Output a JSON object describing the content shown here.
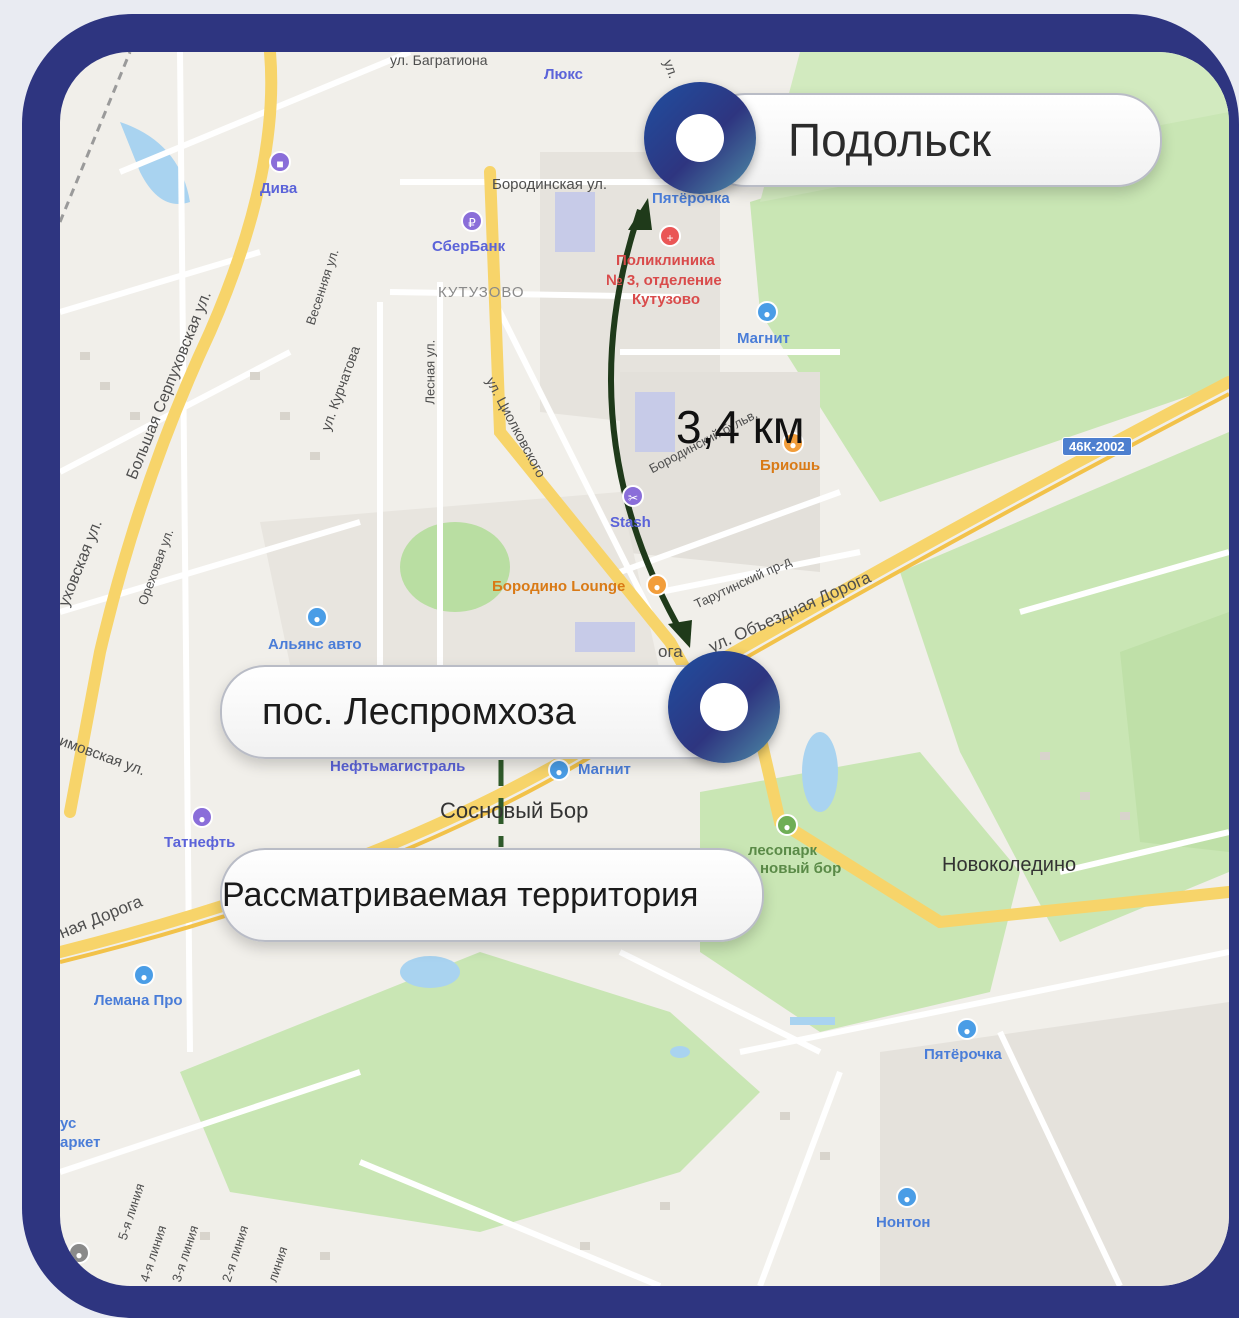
{
  "callouts": {
    "podolsk": "Подольск",
    "lespromhoz": "пос. Леспромхоза",
    "territory": "Рассматриваемая  территория"
  },
  "distance": "3,4 км",
  "streets": {
    "bagrationa": "ул. Багратиона",
    "borodinskaya": "Бородинская ул.",
    "kutuzovo": "КУТУЗОВО",
    "bolshaya_serp": "Большая Серпуховская ул.",
    "serpukhovskaya": "уховская ул.",
    "vesennyaya": "Весенняя ул.",
    "kurchatova": "ул. Курчатова",
    "lesnaya": "Лесная ул.",
    "tsiolkovskogo": "ул. Циолковского",
    "orekhovaya": "Ореховая ул.",
    "borodinsky_bulv": "Бородинский бульв.",
    "tarutinsky": "Тарутинский пр-д",
    "obezdnaya": "ул. Объездная Дорога",
    "obezdnaya_left": "ная Дорога",
    "oga": "ога",
    "imovskaya": "имовская ул.",
    "ul_top": "ул.",
    "line5": "5-я линия",
    "line4": "4-я линия",
    "line3": "3-я линия",
    "line2": "2-я линия",
    "line1": "линия"
  },
  "places": {
    "lyuks": "Люкс",
    "diva": "Дива",
    "pyaterochka_top": "Пятёрочка",
    "sberbank": "СберБанк",
    "poliklinika_1": "Поликлиника",
    "poliklinika_2": "№ 3, отделение",
    "poliklinika_3": "Кутузово",
    "magnit_top": "Магнит",
    "briosh": "Бриошь",
    "stash": "Stash",
    "borodino_lounge": "Бородино Lounge",
    "alyans": "Альянс авто",
    "neftmagistral": "Нефтьмагистраль",
    "magnit_bottom": "Магнит",
    "sosnovy_bor": "Сосновый Бор",
    "tatneft": "Татнефть",
    "lesopark_1": "лесопарк",
    "lesopark_2": "новый бор",
    "novokoledino": "Новоколедино",
    "lemana": "Лемана Про",
    "pyaterochka_bottom": "Пятёрочка",
    "nonton": "Нонтон",
    "market_1": "ус",
    "market_2": "аркет"
  },
  "highway_shield": "46К-2002",
  "colors": {
    "frame": "#2e3580",
    "road_yellow": "#f7d46a",
    "forest": "#c9e6b4",
    "water": "#a9d3f0",
    "arrow": "#1f3a1a"
  }
}
